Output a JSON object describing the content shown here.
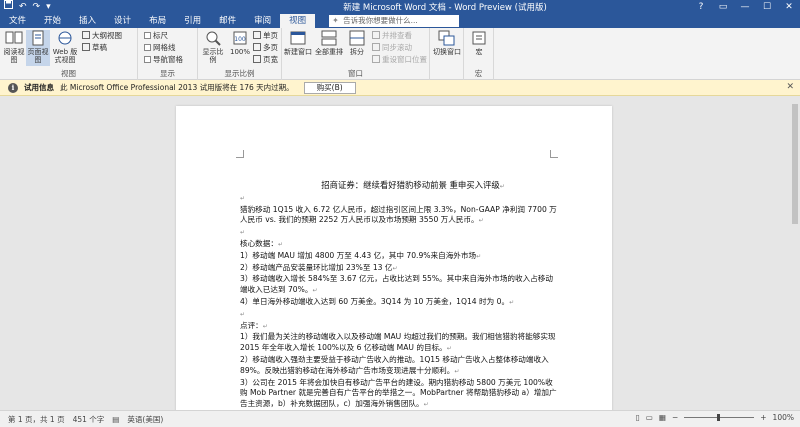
{
  "window": {
    "title": "新建 Microsoft Word 文档 - Word Preview (试用版)",
    "quick_access": [
      "save-icon",
      "undo-icon",
      "redo-icon",
      "customize-icon"
    ],
    "controls": [
      "?",
      "▭",
      "—",
      "☐",
      "✕"
    ]
  },
  "ribbon": {
    "tabs": [
      "文件",
      "开始",
      "插入",
      "设计",
      "布局",
      "引用",
      "邮件",
      "审阅",
      "视图"
    ],
    "active_tab": "视图",
    "tell_me_placeholder": "告诉我你想要做什么...",
    "groups": {
      "views": {
        "label": "视图",
        "read_mode": "阅读视图",
        "print_layout": "页面视图",
        "web_layout": "Web 版式视图",
        "outline": "大纲视图",
        "draft": "草稿"
      },
      "show": {
        "label": "显示",
        "ruler": "标尺",
        "gridlines": "网格线",
        "nav_pane": "导航窗格"
      },
      "zoom": {
        "label": "显示比例",
        "zoom": "显示比例",
        "percent": "100%",
        "one_page": "单页",
        "multi_page": "多页",
        "page_width": "页宽"
      },
      "window": {
        "label": "窗口",
        "new_window": "新建窗口",
        "arrange_all": "全部重排",
        "split": "拆分",
        "side_by_side": "并排查看",
        "sync_scroll": "同步滚动",
        "reset_pos": "重设窗口位置",
        "switch": "切换窗口"
      },
      "macros": {
        "label": "宏",
        "macros": "宏"
      }
    }
  },
  "message_bar": {
    "title": "试用信息",
    "text": "此 Microsoft Office Professional 2013 试用版将在 176 天内过期。",
    "button": "购买(B)"
  },
  "document": {
    "paragraphs": [
      "招商证券：继续看好猎豹移动前景 重申买入评级",
      "",
      "猎豹移动 1Q15 收入 6.72 亿人民币，超过指引区间上限 3.3%，Non-GAAP 净利润 7700 万人民币 vs. 我们的预期 2252 万人民币以及市场预期 3550 万人民币。",
      "",
      "核心数据：",
      "1）移动端 MAU 增加 4800 万至 4.43 亿，其中 70.9%来自海外市场",
      "2）移动端产品安装量环比增加 23%至 13 亿",
      "3）移动端收入增长 584%至 3.67 亿元，占收比达到 55%。其中来自海外市场的收入占移动端收入已达到 70%。",
      "4）单日海外移动端收入达到 60 万美金。3Q14 为 10 万美金，1Q14 时为 0。",
      "",
      "点评：",
      "1）我们最为关注的移动端收入以及移动端 MAU 均超过我们的预期。我们相信猎豹将能够实现 2015 年全年收入增长 100%以及 6 亿移动端 MAU 的目标。",
      "2）移动端收入强劲主要受益于移动广告收入的推动。1Q15 移动广告收入占整体移动端收入 89%。反映出猎豹移动在海外移动广告市场变现进展十分顺利。",
      "3）公司在 2015 年将会加快自有移动广告平台的建设。期内猎豹移动 5800 万美元 100%收购 Mob Partner 就是完善自有广告平台的举措之一。MobPartner 将帮助猎豹移动 a）增加广告主资源，b）补充数据团队，c）加强海外销售团队。"
    ],
    "paragraph_mark": "↵"
  },
  "status": {
    "page": "第 1 页，共 1 页",
    "words": "451 个字",
    "language": "英语(美国)",
    "zoom": "100%"
  },
  "colors": {
    "brand": "#2b579a",
    "message_bar": "#fff4ce"
  }
}
